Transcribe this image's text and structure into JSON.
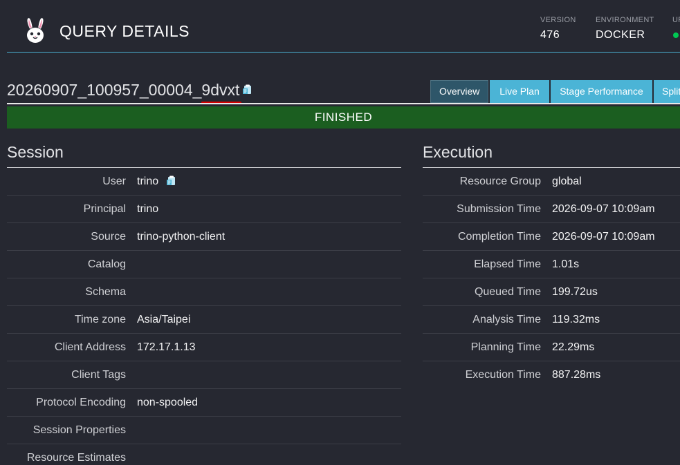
{
  "header": {
    "title": "QUERY DETAILS",
    "logo_icon": "bunny-logo-icon",
    "meta": [
      {
        "label": "VERSION",
        "value": "476"
      },
      {
        "label": "ENVIRONMENT",
        "value": "DOCKER"
      },
      {
        "label": "UPTIME",
        "value": ""
      }
    ],
    "status_color": "#00c853"
  },
  "query": {
    "id_prefix": "20260907_100957_00004_",
    "id_suffix": "9dvxt",
    "copy_icon": "clipboard-copy-icon",
    "state": "FINISHED",
    "state_color": "#1b5e20"
  },
  "tabs": [
    {
      "label": "Overview",
      "active": true
    },
    {
      "label": "Live Plan",
      "active": false
    },
    {
      "label": "Stage Performance",
      "active": false
    },
    {
      "label": "Splits",
      "active": false
    }
  ],
  "session": {
    "title": "Session",
    "rows": [
      {
        "label": "User",
        "value": "trino"
      },
      {
        "label": "Principal",
        "value": "trino"
      },
      {
        "label": "Source",
        "value": "trino-python-client"
      },
      {
        "label": "Catalog",
        "value": ""
      },
      {
        "label": "Schema",
        "value": ""
      },
      {
        "label": "Time zone",
        "value": "Asia/Taipei"
      },
      {
        "label": "Client Address",
        "value": "172.17.1.13"
      },
      {
        "label": "Client Tags",
        "value": ""
      },
      {
        "label": "Protocol Encoding",
        "value": "non-spooled"
      },
      {
        "label": "Session Properties",
        "value": ""
      },
      {
        "label": "Resource Estimates",
        "value": ""
      }
    ]
  },
  "execution": {
    "title": "Execution",
    "rows": [
      {
        "label": "Resource Group",
        "value": "global"
      },
      {
        "label": "Submission Time",
        "value": "2026-09-07 10:09am"
      },
      {
        "label": "Completion Time",
        "value": "2026-09-07 10:09am"
      },
      {
        "label": "Elapsed Time",
        "value": "1.01s"
      },
      {
        "label": "Queued Time",
        "value": "199.72us"
      },
      {
        "label": "Analysis Time",
        "value": "119.32ms"
      },
      {
        "label": "Planning Time",
        "value": "22.29ms"
      },
      {
        "label": "Execution Time",
        "value": "887.28ms"
      }
    ]
  },
  "colors": {
    "background": "#262831",
    "accent": "#4bb4d6",
    "active_tab": "#2e5669",
    "highlight_underline": "#d50000"
  }
}
